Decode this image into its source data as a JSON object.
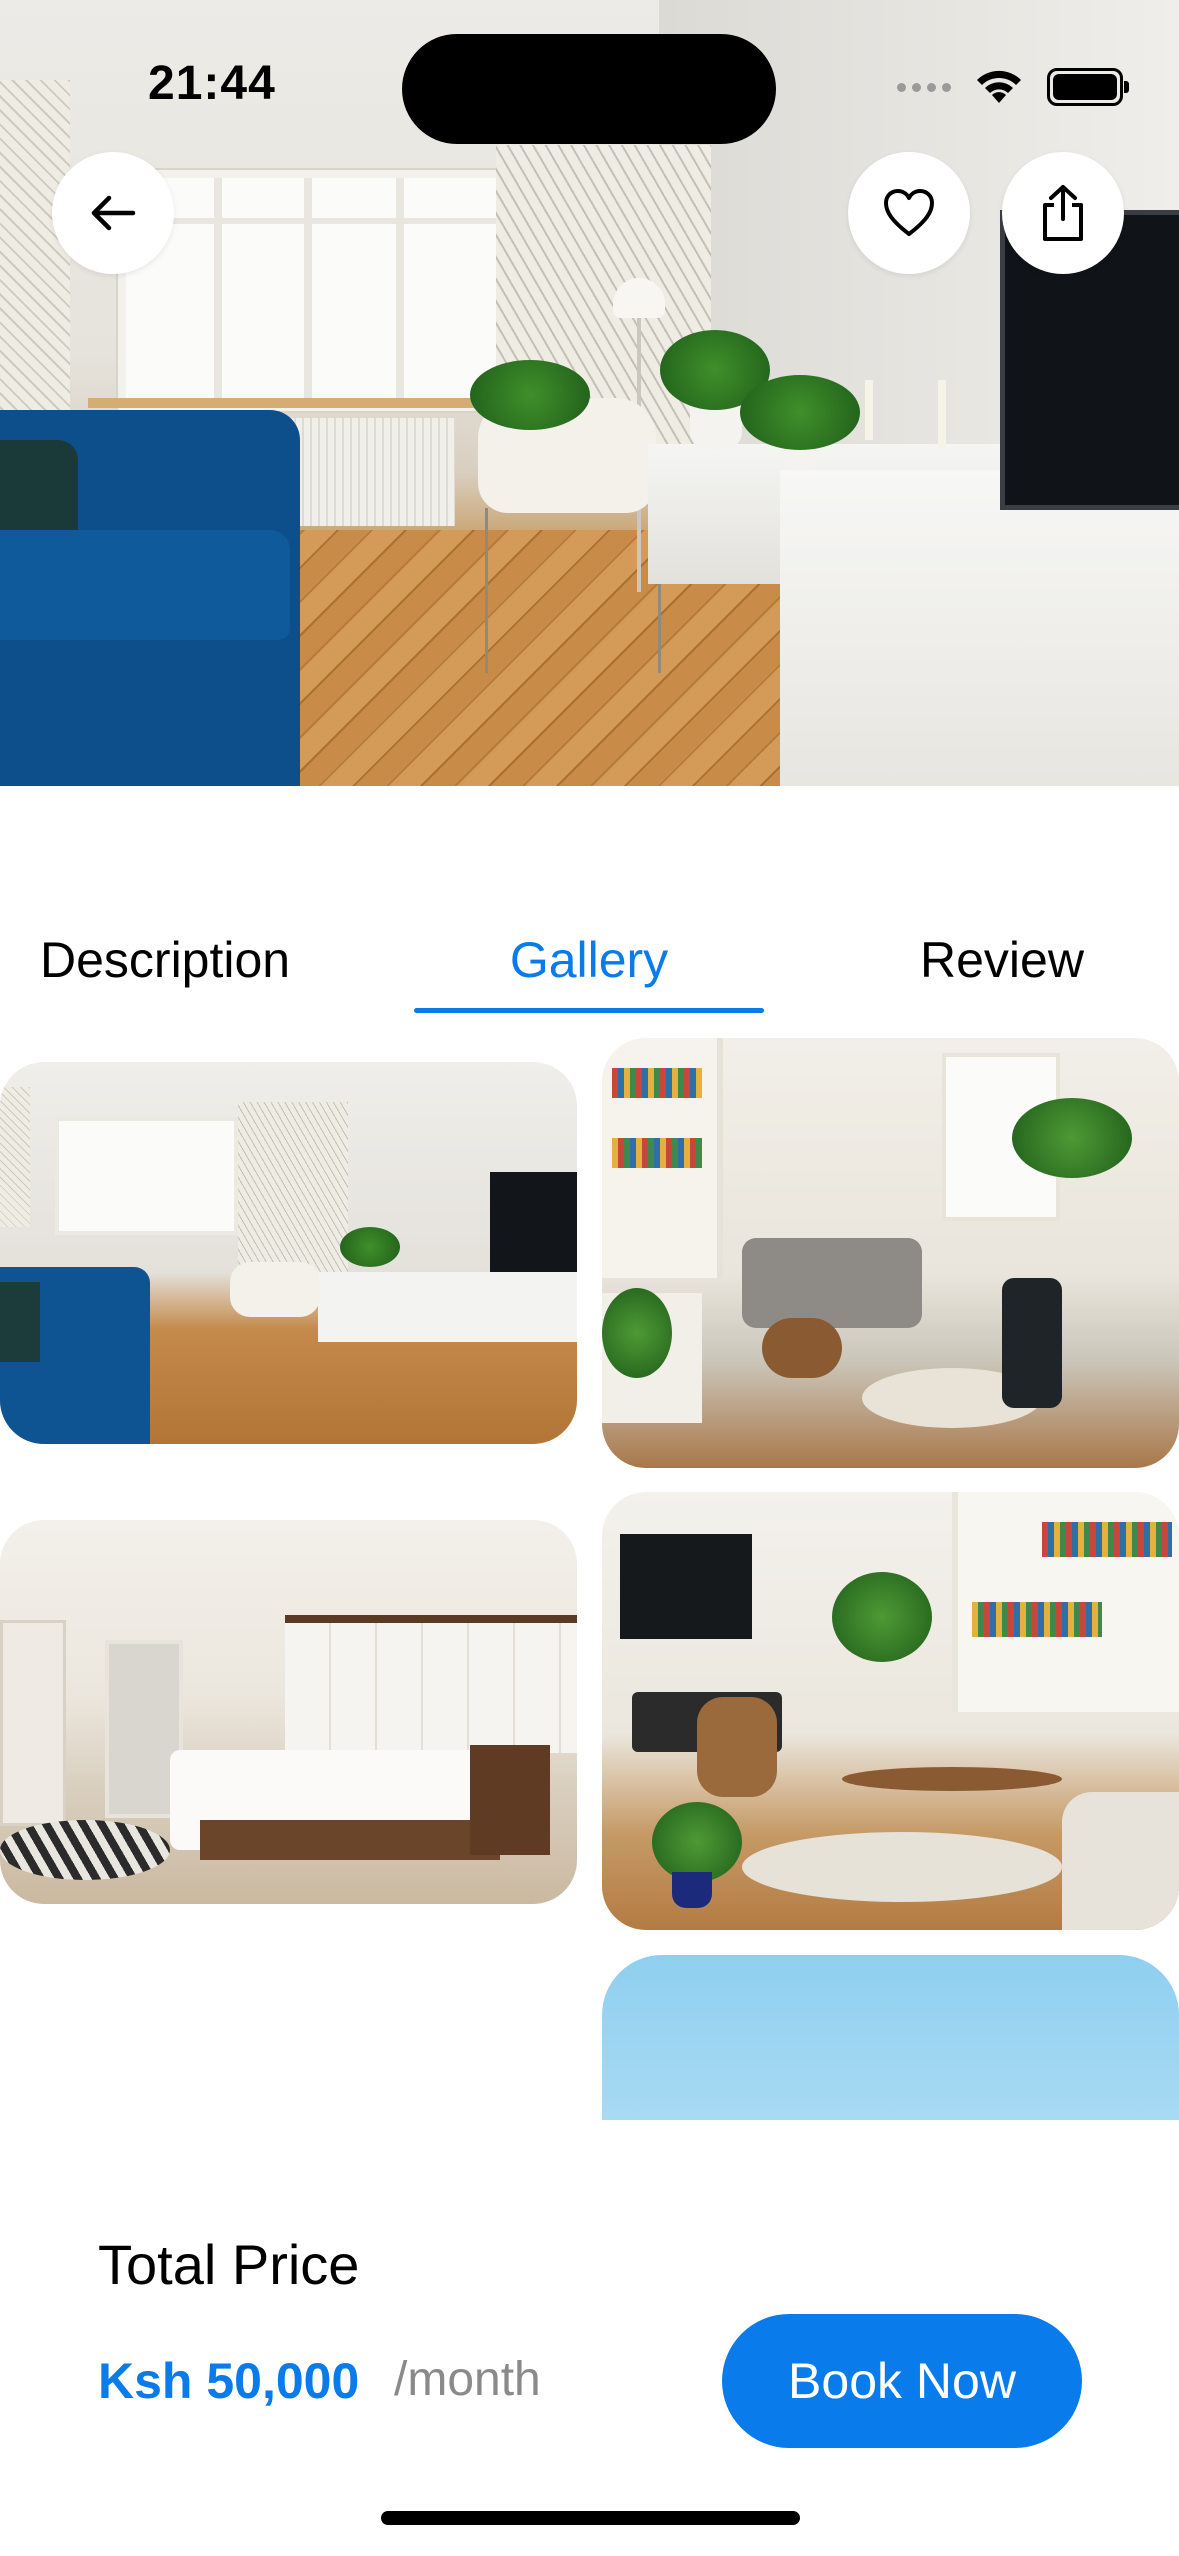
{
  "status_bar": {
    "time": "21:44"
  },
  "hero": {
    "back_icon": "arrow-left-icon",
    "favorite_icon": "heart-icon",
    "share_icon": "share-icon"
  },
  "tabs": [
    {
      "label": "Description",
      "active": false
    },
    {
      "label": "Gallery",
      "active": true
    },
    {
      "label": "Review",
      "active": false
    }
  ],
  "gallery": {
    "photos": [
      {
        "subject": "living room with blue sofa and TV console"
      },
      {
        "subject": "living room with grey sofa and bookshelves"
      },
      {
        "subject": "bedroom with white headboard"
      },
      {
        "subject": "living room with wooden chair and plants"
      },
      {
        "subject": "sky view"
      }
    ]
  },
  "footer": {
    "total_label": "Total Price",
    "price": "Ksh 50,000",
    "period": "/month",
    "book_label": "Book Now"
  },
  "colors": {
    "accent": "#0a7bea",
    "muted": "#8a8a8a"
  }
}
